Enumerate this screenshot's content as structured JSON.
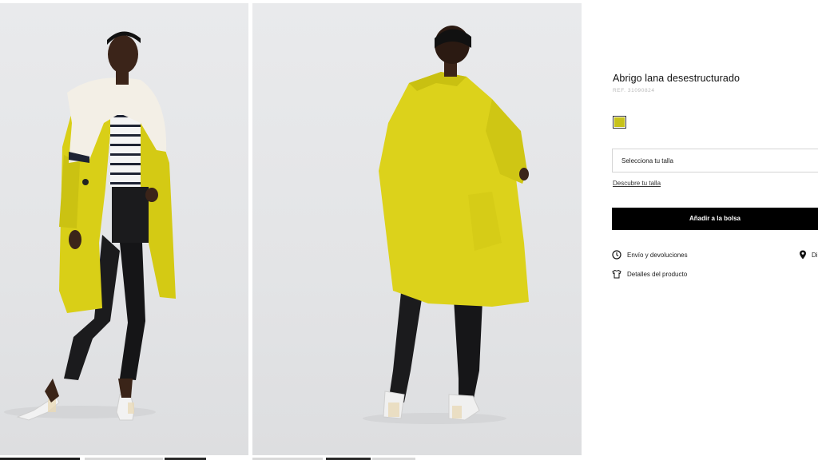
{
  "product": {
    "title": "Abrigo lana desestructurado",
    "ref": "REF. 31090824",
    "color_swatch": "#c7c21a"
  },
  "size_selector": {
    "placeholder": "Selecciona tu talla"
  },
  "size_guide_link": "Descubre tu talla",
  "add_to_bag_label": "Añadir a la bolsa",
  "info_links": {
    "shipping": "Envío y devoluciones",
    "details": "Detalles del producto",
    "store_truncated": "Di"
  },
  "icons": {
    "shipping": "clock-icon",
    "details": "tshirt-icon",
    "store": "map-pin-icon"
  },
  "colors": {
    "coat_yellow": "#d8cf16",
    "button_black": "#000000",
    "photo_bg": "#e5e6e8"
  }
}
